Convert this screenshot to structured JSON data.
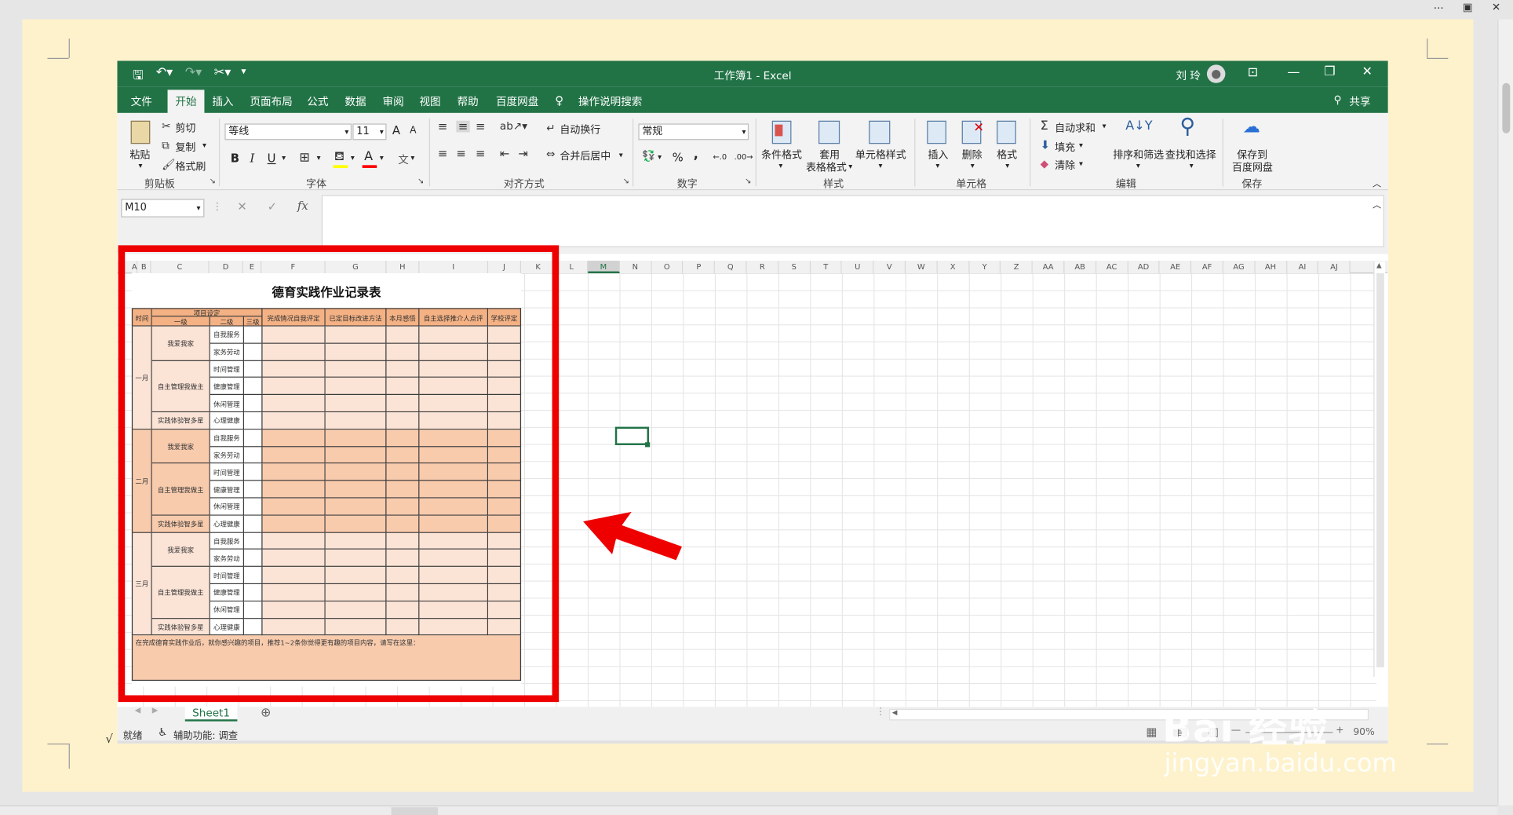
{
  "word": {
    "more": "···",
    "restore": "▣",
    "close": "✕"
  },
  "title": {
    "workbook": "工作簿1 - Excel",
    "user": "刘 玲",
    "ribbon_display": "⊡",
    "min": "—",
    "max": "❐",
    "close": "✕"
  },
  "tabs": [
    {
      "label": "文件"
    },
    {
      "label": "开始"
    },
    {
      "label": "插入"
    },
    {
      "label": "页面布局"
    },
    {
      "label": "公式"
    },
    {
      "label": "数据"
    },
    {
      "label": "审阅"
    },
    {
      "label": "视图"
    },
    {
      "label": "帮助"
    },
    {
      "label": "百度网盘"
    },
    {
      "label": "操作说明搜索"
    }
  ],
  "share": "共享",
  "clipboard": {
    "paste": "粘贴",
    "cut": "剪切",
    "copy": "复制",
    "painter": "格式刷",
    "label": "剪贴板"
  },
  "font": {
    "name": "等线",
    "size": "11",
    "grow": "A",
    "shrink": "A",
    "bold": "B",
    "italic": "I",
    "underline": "U",
    "color_a": "A",
    "wen": "文",
    "label": "字体"
  },
  "align": {
    "wrap": "自动换行",
    "merge": "合并后居中",
    "label": "对齐方式"
  },
  "number": {
    "format": "常规",
    "pct": "%",
    "comma": ",",
    "label": "数字"
  },
  "styles": {
    "cond": "条件格式",
    "table1": "套用",
    "table2": "表格格式",
    "cell": "单元格样式",
    "label": "样式"
  },
  "cells": {
    "insert": "插入",
    "delete": "删除",
    "format": "格式",
    "label": "单元格"
  },
  "edit": {
    "autosum": "自动求和",
    "fill": "填充",
    "clear": "清除",
    "sort": "排序和筛选",
    "find": "查找和选择",
    "label": "编辑"
  },
  "save": {
    "line1": "保存到",
    "line2": "百度网盘",
    "label": "保存"
  },
  "formula": {
    "namebox": "M10",
    "fx": "fx",
    "cancel": "✕",
    "enter": "✓"
  },
  "columns": [
    "A",
    "B",
    "C",
    "D",
    "E",
    "F",
    "G",
    "H",
    "I",
    "J",
    "K",
    "L",
    "M",
    "N",
    "O",
    "P",
    "Q",
    "R",
    "S",
    "T",
    "U",
    "V",
    "W",
    "X",
    "Y",
    "Z",
    "AA",
    "AB",
    "AC",
    "AD",
    "AE",
    "AF",
    "AG",
    "AH",
    "AI",
    "AJ"
  ],
  "record": {
    "title": "德育实践作业记录表",
    "headers": {
      "time": "时间",
      "setting": "项目设定",
      "l1": "一级",
      "l2": "二级",
      "l3": "三级",
      "done": "完成情况自我评定",
      "goal": "已定目标改进方法",
      "feel": "本月感悟",
      "pick": "自主选择推介人点评",
      "school": "学校评定"
    },
    "months": [
      "一月",
      "二月",
      "三月"
    ],
    "cat1": [
      "我爱我家",
      "自主管理我做主",
      "实践体验智多星"
    ],
    "cat2": [
      "自我服务",
      "家务劳动",
      "时间管理",
      "健康管理",
      "休闲管理",
      "心理健康"
    ],
    "note": "在完成德育实践作业后，就你感兴趣的项目，推荐1~2条你觉得更有趣的项目内容，请写在这里："
  },
  "sheet_tab": "Sheet1",
  "status": {
    "ready": "就绪",
    "access": "辅助功能: 调查",
    "zoom": "90%",
    "check": "√"
  },
  "watermark": {
    "line1": "Bai 经验",
    "line2": "jingyan.baidu.com"
  }
}
